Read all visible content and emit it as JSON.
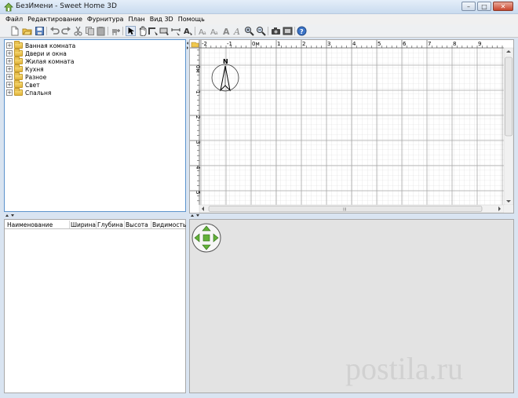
{
  "window": {
    "title": "БезИмени - Sweet Home 3D",
    "minimize": "–",
    "maximize": "□",
    "close": "✕"
  },
  "menu": [
    "Файл",
    "Редактирование",
    "Фурнитура",
    "План",
    "Вид 3D",
    "Помощь"
  ],
  "toolbar_icons": [
    "new-file-icon",
    "open-icon",
    "save-icon",
    "undo-icon",
    "redo-icon",
    "cut-icon",
    "copy-icon",
    "paste-icon",
    "add-furniture-icon",
    "select-icon",
    "pan-icon",
    "create-walls-icon",
    "create-rooms-icon",
    "create-dimensions-icon",
    "add-text-icon",
    "text-style-icon",
    "bold-icon",
    "italic-icon",
    "text-size-icon",
    "zoom-in-icon",
    "zoom-out-icon",
    "create-photo-icon",
    "create-video-icon",
    "help-icon"
  ],
  "catalog": {
    "categories": [
      "Ванная комната",
      "Двери и окна",
      "Жилая комната",
      "Кухня",
      "Разное",
      "Свет",
      "Спальня"
    ]
  },
  "furniture_table": {
    "columns": [
      "Наименование",
      "Ширина",
      "Глубина",
      "Высота",
      "Видимость"
    ]
  },
  "plan": {
    "x_ticks": [
      "-2",
      "-1",
      "0м",
      "1",
      "2",
      "3",
      "4",
      "5",
      "6",
      "7",
      "8",
      "9"
    ],
    "y_ticks": [
      "0м",
      "1",
      "2",
      "3",
      "4",
      "5"
    ],
    "compass_label": "N",
    "scroll_grip": "III"
  },
  "watermark": {
    "text": "postila",
    "dot": ".",
    "suffix": "ru"
  }
}
